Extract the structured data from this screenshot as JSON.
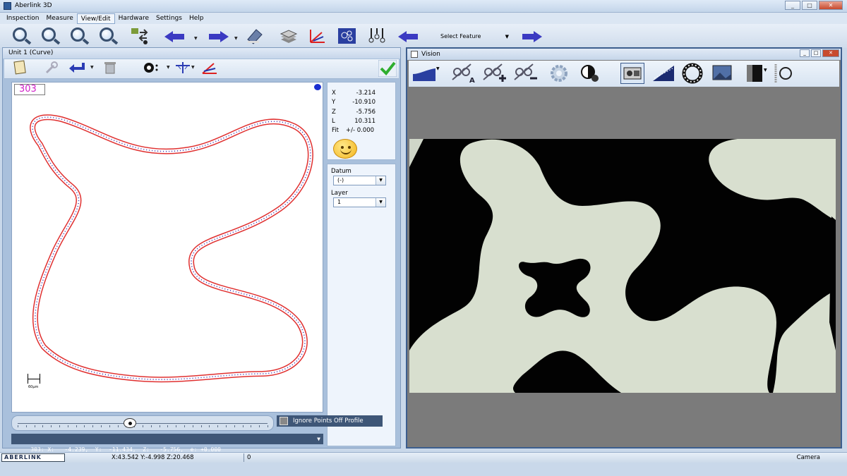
{
  "app": {
    "title": "Aberlink 3D"
  },
  "window_controls": {
    "minimize": "_",
    "restore": "□",
    "close": "✕"
  },
  "menu": [
    "Inspection",
    "Measure",
    "View/Edit",
    "Hardware",
    "Settings",
    "Help"
  ],
  "menu_active": "View/Edit",
  "toolbar": {
    "select_feature": "Select Feature",
    "icons": [
      "zoom-icon",
      "zoom-out-icon",
      "zoom-previous-icon",
      "zoom-all-icon",
      "transfer-icon",
      "undo-arrow-icon",
      "redo-arrow-icon",
      "eraser-icon",
      "layers-icon",
      "datum-axes-icon",
      "circles-icon",
      "probe-icon",
      "back-arrow-icon",
      "forward-arrow-icon"
    ]
  },
  "unit_panel": {
    "title": "Unit 1 (Curve)",
    "point_id": "303",
    "scale_label": "60µm",
    "coords": [
      {
        "k": "X",
        "v": "-3.214"
      },
      {
        "k": "Y",
        "v": "-10.910"
      },
      {
        "k": "Z",
        "v": "-5.756"
      },
      {
        "k": "L",
        "v": "10.311"
      },
      {
        "k": "Fit",
        "v": "+/- 0.000"
      }
    ],
    "datum_label": "Datum",
    "datum_value": "(-)",
    "layer_label": "Layer",
    "layer_value": "1",
    "ignore_label": "Ignore Points Off Profile",
    "point_info": "303: X:   -4.239,  Y:  -11.434,  Z:   -5.756,  e: +0.000",
    "slider_fraction": 0.45
  },
  "vision": {
    "title": "Vision"
  },
  "status": {
    "logo": "ABERLINK",
    "xyz": "X:43.542 Y:-4.998 Z:20.468",
    "count": "0",
    "mode": "Camera"
  },
  "colors": {
    "curve": "#e03030",
    "point": "#3a2fb0",
    "point_id": "#d11fc8",
    "accent": "#3b3ac2"
  }
}
